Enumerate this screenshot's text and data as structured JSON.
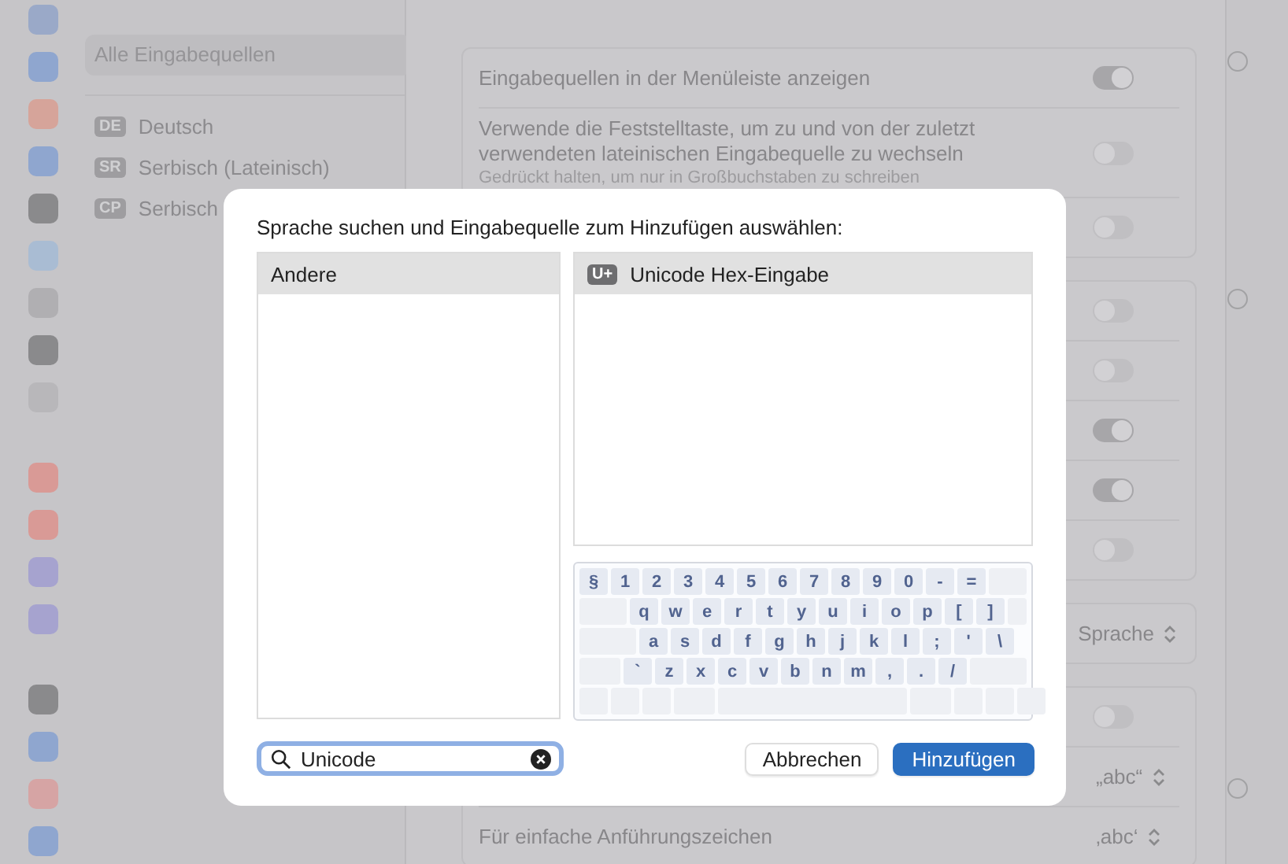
{
  "source_list": {
    "header": "Alle Eingabequellen",
    "items": [
      {
        "badge": "DE",
        "name": "Deutsch"
      },
      {
        "badge": "SR",
        "name": "Serbisch (Lateinisch)"
      },
      {
        "badge": "CP",
        "name": "Serbisch"
      }
    ]
  },
  "settings": {
    "groups": [
      {
        "rows": [
          {
            "kind": "toggle",
            "label": "Eingabequellen in der Menüleiste anzeigen",
            "on": true
          },
          {
            "kind": "toggle",
            "label": "Verwende die Feststelltaste, um zu und von der zuletzt verwendeten lateinischen Eingabequelle zu wechseln",
            "hint": "Gedrückt halten, um nur in Großbuchstaben zu schreiben",
            "on": false
          },
          {
            "kind": "toggle",
            "on": false
          }
        ]
      },
      {
        "rows": [
          {
            "kind": "toggle",
            "on": false
          },
          {
            "kind": "toggle",
            "on": false
          },
          {
            "kind": "toggle",
            "on": true
          },
          {
            "kind": "toggle",
            "on": true
          },
          {
            "kind": "toggle",
            "on": false
          }
        ]
      },
      {
        "rows": [
          {
            "kind": "popup",
            "value": "Sprache"
          }
        ]
      },
      {
        "rows": [
          {
            "kind": "toggle",
            "on": false
          },
          {
            "kind": "popup",
            "value": "„abc“"
          },
          {
            "kind": "popup",
            "label": "Für einfache Anführungszeichen",
            "value": "‚abc‘"
          }
        ]
      }
    ]
  },
  "dialog": {
    "title": "Sprache suchen und Eingabequelle zum Hinzufügen auswählen:",
    "languages": [
      {
        "label": "Andere",
        "selected": true
      }
    ],
    "sources": [
      {
        "badge": "U+",
        "label": "Unicode Hex-Eingabe",
        "selected": true
      }
    ],
    "keyboard": [
      [
        "§",
        "1",
        "2",
        "3",
        "4",
        "5",
        "6",
        "7",
        "8",
        "9",
        "0",
        "-",
        "="
      ],
      [
        "q",
        "w",
        "e",
        "r",
        "t",
        "y",
        "u",
        "i",
        "o",
        "p",
        "[",
        "]"
      ],
      [
        "a",
        "s",
        "d",
        "f",
        "g",
        "h",
        "j",
        "k",
        "l",
        ";",
        "'",
        "\\"
      ],
      [
        "`",
        "z",
        "x",
        "c",
        "v",
        "b",
        "n",
        "m",
        ",",
        ".",
        "/"
      ]
    ],
    "search": {
      "value": "Unicode"
    },
    "buttons": [
      {
        "kind": "cancel",
        "label": "Abbrechen"
      },
      {
        "kind": "primary",
        "label": "Hinzufügen"
      }
    ]
  }
}
